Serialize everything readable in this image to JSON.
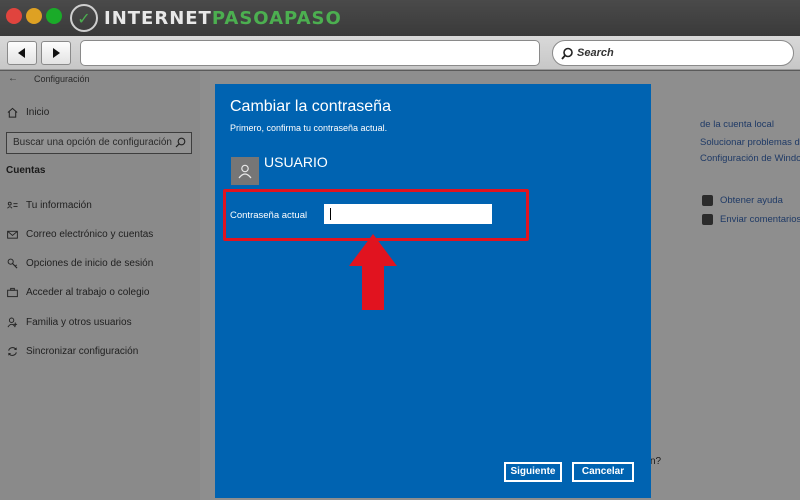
{
  "browser": {
    "brand_part1": "INTERNET",
    "brand_part2": "PASOAPASO",
    "search_placeholder": "Search"
  },
  "settings": {
    "header_title": "Configuración",
    "home_label": "Inicio",
    "search_placeholder": "Buscar una opción de configuración",
    "section_title": "Cuentas",
    "sidebar_items": [
      {
        "label": "Tu información",
        "icon": "person-card-icon"
      },
      {
        "label": "Correo electrónico y cuentas",
        "icon": "mail-icon"
      },
      {
        "label": "Opciones de inicio de sesión",
        "icon": "key-icon"
      },
      {
        "label": "Acceder al trabajo o colegio",
        "icon": "briefcase-icon"
      },
      {
        "label": "Familia y otros usuarios",
        "icon": "person-add-icon"
      },
      {
        "label": "Sincronizar configuración",
        "icon": "sync-icon"
      }
    ],
    "right_links": [
      "de la cuenta local",
      "Solucionar problemas de",
      "Configuración de Windo"
    ],
    "help_links": [
      {
        "label": "Obtener ayuda",
        "icon": "chat-help-icon"
      },
      {
        "label": "Enviar comentarios",
        "icon": "feedback-icon"
      }
    ],
    "trailing_text": "n?"
  },
  "dialog": {
    "title": "Cambiar la contraseña",
    "subtitle": "Primero, confirma tu contraseña actual.",
    "username": "USUARIO",
    "password_label": "Contraseña actual",
    "password_value": "",
    "next_label": "Siguiente",
    "cancel_label": "Cancelar",
    "bg_color": "#0063b1"
  },
  "annotation": {
    "highlight_color": "#e1131f"
  }
}
